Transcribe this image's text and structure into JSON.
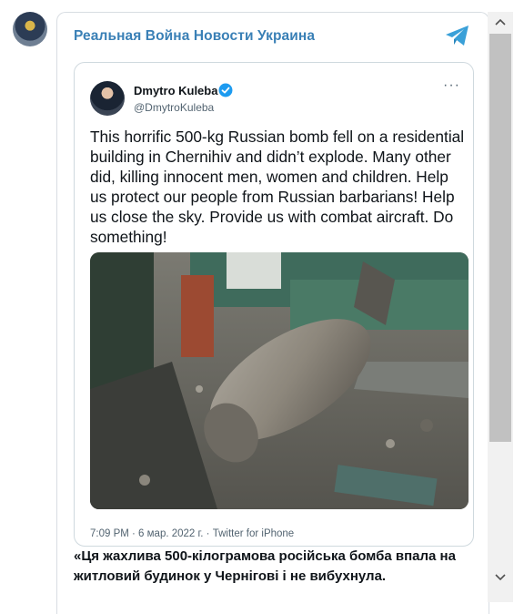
{
  "channel": {
    "title": "Реальная Война Новости Украина",
    "accent": "#3a80b6",
    "icon": "telegram-paper-plane-icon"
  },
  "tweet": {
    "author_name": "Dmytro Kuleba",
    "handle": "@DmytroKuleba",
    "verified_icon": "verified-badge-icon",
    "more_icon": "more-options-icon",
    "text": "This horrific 500-kg Russian bomb fell on a residential building in Chernihiv and didn’t explode. Many other did, killing innocent men, women and children. Help us protect our people from Russian barbarians! Help us close the sky. Provide us with combat aircraft. Do something!",
    "footer": "7:09 PM · 6 мар. 2022 г. · Twitter for iPhone"
  },
  "caption": "«Ця жахлива 500-кілограмова російська бомба впала на житловий будинок у Чернігові і не вибухнула.",
  "scrollbar": {
    "up_icon": "chevron-up-icon",
    "down_icon": "chevron-down-icon"
  }
}
